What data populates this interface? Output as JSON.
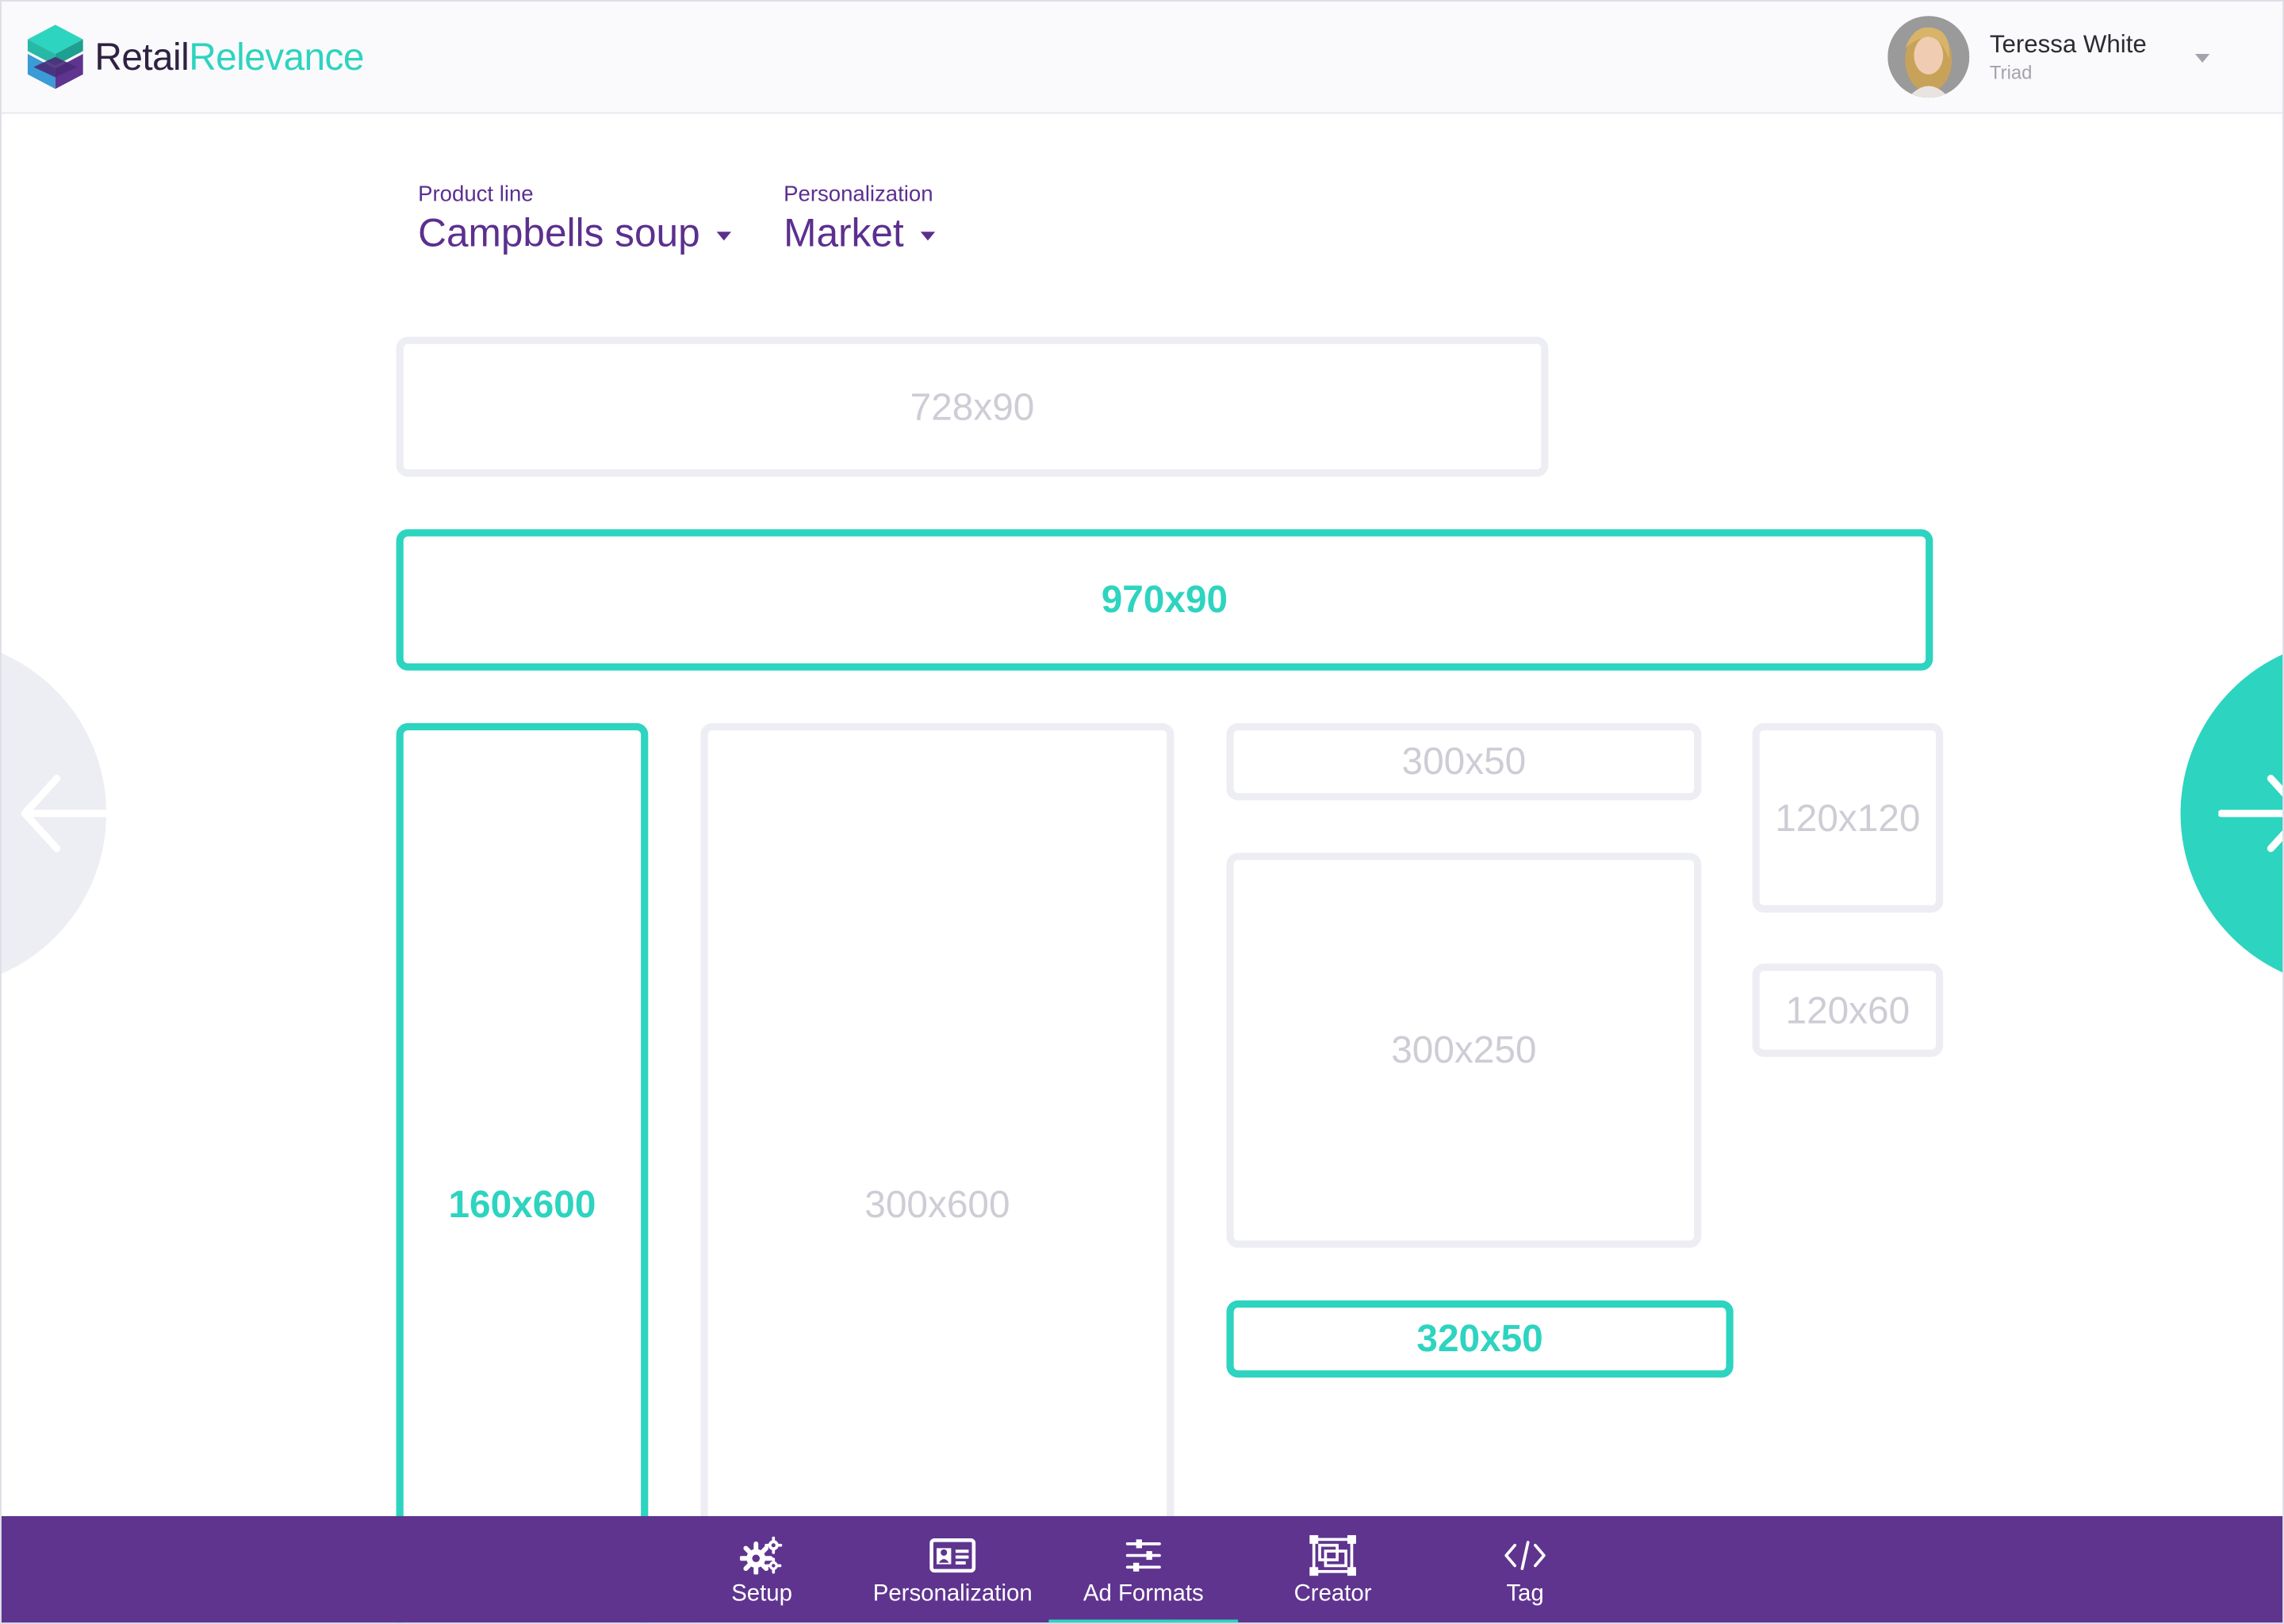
{
  "brand": {
    "name_part1": "Retail",
    "name_part2": "Relevance",
    "accent_color": "#2dd4bf",
    "primary_color": "#5f348f"
  },
  "user": {
    "name": "Teressa White",
    "org": "Triad"
  },
  "filters": {
    "product_line": {
      "label": "Product line",
      "value": "Campbells soup"
    },
    "personalization": {
      "label": "Personalization",
      "value": "Market"
    }
  },
  "formats": {
    "f728x90": {
      "label": "728x90",
      "selected": false
    },
    "f970x90": {
      "label": "970x90",
      "selected": true
    },
    "f160x600": {
      "label": "160x600",
      "selected": true
    },
    "f300x600": {
      "label": "300x600",
      "selected": false
    },
    "f300x50": {
      "label": "300x50",
      "selected": false
    },
    "f300x250": {
      "label": "300x250",
      "selected": false
    },
    "f320x50": {
      "label": "320x50",
      "selected": true
    },
    "f120x120": {
      "label": "120x120",
      "selected": false
    },
    "f120x60": {
      "label": "120x60",
      "selected": false
    }
  },
  "navigation": {
    "prev_icon": "arrow-left-icon",
    "next_icon": "arrow-right-icon"
  },
  "tabs": [
    {
      "label": "Setup",
      "icon": "gears-icon",
      "active": false
    },
    {
      "label": "Personalization",
      "icon": "id-card-icon",
      "active": false
    },
    {
      "label": "Ad Formats",
      "icon": "sliders-icon",
      "active": true
    },
    {
      "label": "Creator",
      "icon": "layers-frame-icon",
      "active": false
    },
    {
      "label": "Tag",
      "icon": "code-icon",
      "active": false
    }
  ]
}
